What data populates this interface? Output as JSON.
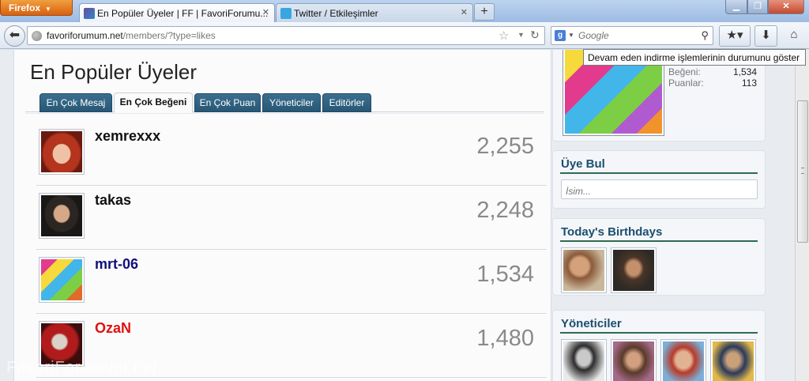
{
  "browser": {
    "menu_label": "Firefox",
    "tabs": [
      {
        "title": "En Popüler Üyeler | FF | FavoriForumu...",
        "active": true
      },
      {
        "title": "Twitter / Etkileşimler",
        "active": false
      }
    ],
    "new_tab_label": "+",
    "url_domain": "favoriforumum.net",
    "url_path": "/members/?type=likes",
    "search_placeholder": "Google",
    "tooltip": "Devam eden indirme işlemlerinin durumunu göster"
  },
  "page": {
    "title": "En Popüler Üyeler",
    "tabs": [
      {
        "label": "En Çok Mesaj",
        "selected": false
      },
      {
        "label": "En Çok Beğeni",
        "selected": true
      },
      {
        "label": "En Çok Puan",
        "selected": false
      },
      {
        "label": "Yöneticiler",
        "selected": false
      },
      {
        "label": "Editörler",
        "selected": false
      }
    ],
    "members": [
      {
        "name": "xemrexxx",
        "count": "2,255",
        "color": "#111111"
      },
      {
        "name": "takas",
        "count": "2,248",
        "color": "#111111"
      },
      {
        "name": "mrt-06",
        "count": "1,534",
        "color": "#10107a"
      },
      {
        "name": "OzaN",
        "count": "1,480",
        "color": "#e01010"
      }
    ],
    "watermark": "FavoriForumum.net"
  },
  "sidebar": {
    "user_stats": [
      {
        "label": "Beğeni:",
        "value": "1,534"
      },
      {
        "label": "Puanlar:",
        "value": "113"
      }
    ],
    "find_member": {
      "title": "Üye Bul",
      "placeholder": "İsim..."
    },
    "birthdays": {
      "title": "Today's Birthdays"
    },
    "admins": {
      "title": "Yöneticiler"
    }
  },
  "colors": {
    "tab_blue": "#285775",
    "sidebar_heading": "#1c4f6d",
    "heading_underline": "#2e6b52"
  }
}
